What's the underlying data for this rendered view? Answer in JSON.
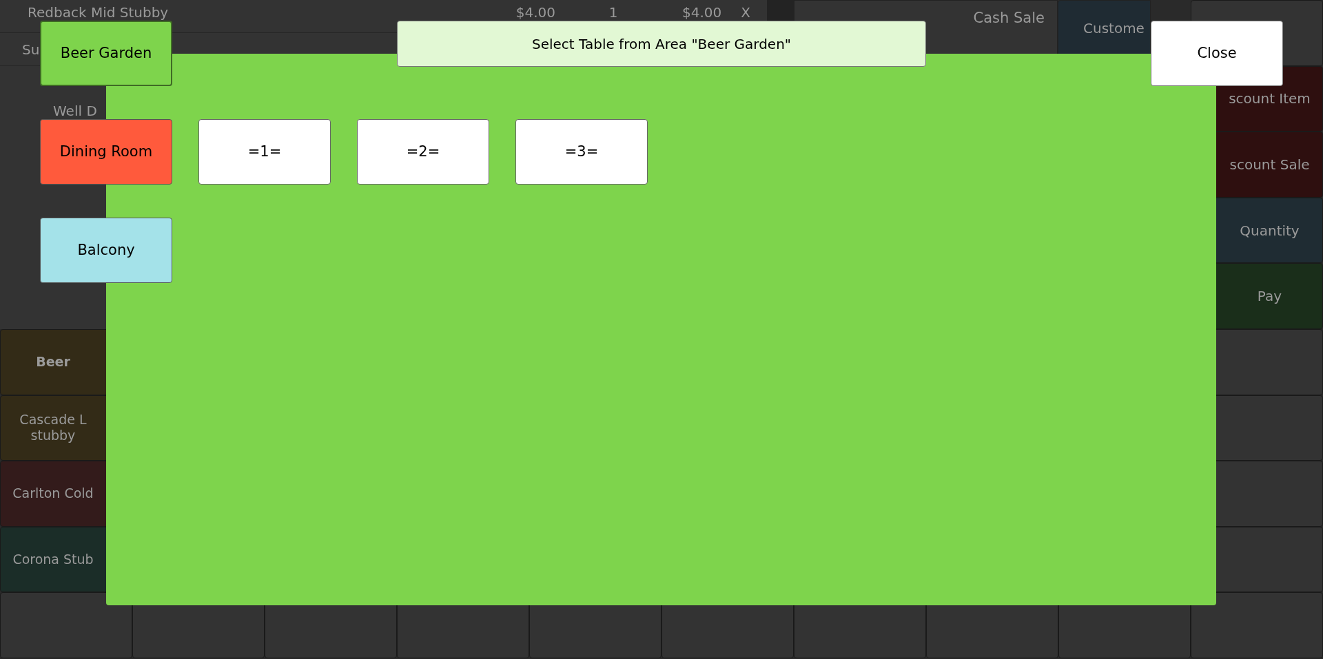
{
  "order_lines": [
    {
      "item": "Redback Mid Stubby",
      "price": "$4.00",
      "qty": "1",
      "total": "$4.00",
      "remove": "X"
    },
    {
      "item": "Su"
    }
  ],
  "modifiers": [
    "Well D"
  ],
  "sale_type": "Cash Sale",
  "customer_button": {
    "label": "Custome",
    "color": "#1f2b33"
  },
  "side_buttons": [
    {
      "color": "#333333"
    },
    {
      "label": "scount Item",
      "color": "#2e0f0f"
    },
    {
      "label": "scount Sale",
      "color": "#2e0f0f"
    },
    {
      "label": "Quantity",
      "color": "#1f2c33"
    },
    {
      "label": "Pay",
      "color": "#1a2e1a"
    }
  ],
  "products": [
    {
      "label": "Beer",
      "bold": true,
      "color": "#332b17"
    },
    {
      "label": "Cascade L\nstubby",
      "bold": false,
      "color": "#332b17"
    },
    {
      "label": "Carlton Cold",
      "bold": false,
      "color": "#331b1b"
    },
    {
      "label": "Corona Stub",
      "bold": false,
      "color": "#1b2d28"
    }
  ],
  "table_dialog": {
    "title": "Select Table from Area \"Beer Garden\"",
    "close": "Close",
    "areas": [
      {
        "label": "Beer Garden",
        "color": "#7ed44c",
        "selected": true
      },
      {
        "label": "Dining Room",
        "color": "#ff5a3c",
        "selected": false
      },
      {
        "label": "Balcony",
        "color": "#a4e2e9",
        "selected": false
      }
    ],
    "tables": [
      "=1=",
      "=2=",
      "=3="
    ]
  }
}
